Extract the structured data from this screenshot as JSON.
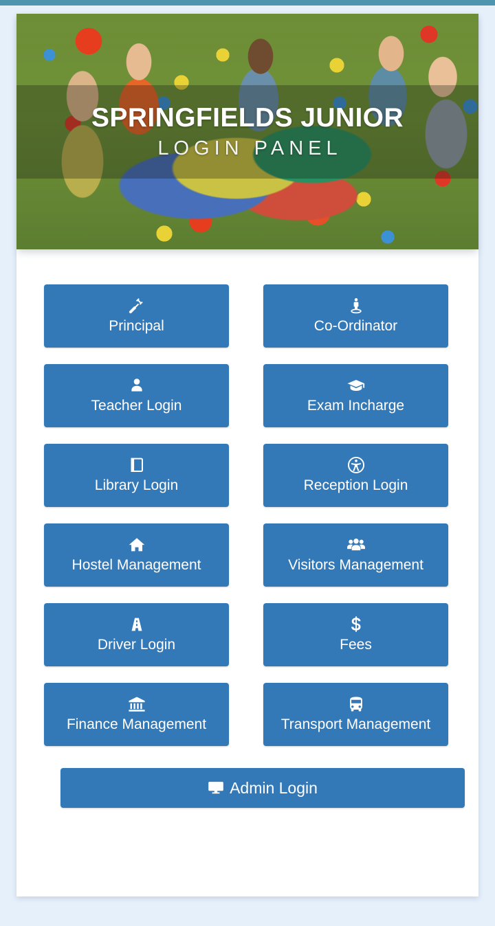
{
  "theme": {
    "accent_bar_color": "#4d95ae",
    "page_background": "#e6f0fb",
    "card_background": "#ffffff",
    "button_color": "#3479b7",
    "button_text_color": "#ffffff"
  },
  "hero": {
    "title": "SPRINGFIELDS JUNIOR",
    "subtitle": "LOGIN PANEL"
  },
  "grid": {
    "buttons": [
      {
        "label": "Principal",
        "icon": "gavel-icon"
      },
      {
        "label": "Co-Ordinator",
        "icon": "person-podium-icon"
      },
      {
        "label": "Teacher Login",
        "icon": "user-icon"
      },
      {
        "label": "Exam Incharge",
        "icon": "graduation-cap-icon"
      },
      {
        "label": "Library Login",
        "icon": "book-icon"
      },
      {
        "label": "Reception Login",
        "icon": "universal-access-icon"
      },
      {
        "label": "Hostel Management",
        "icon": "home-icon"
      },
      {
        "label": "Visitors Management",
        "icon": "users-group-icon"
      },
      {
        "label": "Driver Login",
        "icon": "road-icon"
      },
      {
        "label": "Fees",
        "icon": "dollar-sign-icon"
      },
      {
        "label": "Finance Management",
        "icon": "bank-icon"
      },
      {
        "label": "Transport Management",
        "icon": "bus-icon"
      }
    ]
  },
  "admin": {
    "label": "Admin Login",
    "icon": "desktop-monitor-icon"
  }
}
